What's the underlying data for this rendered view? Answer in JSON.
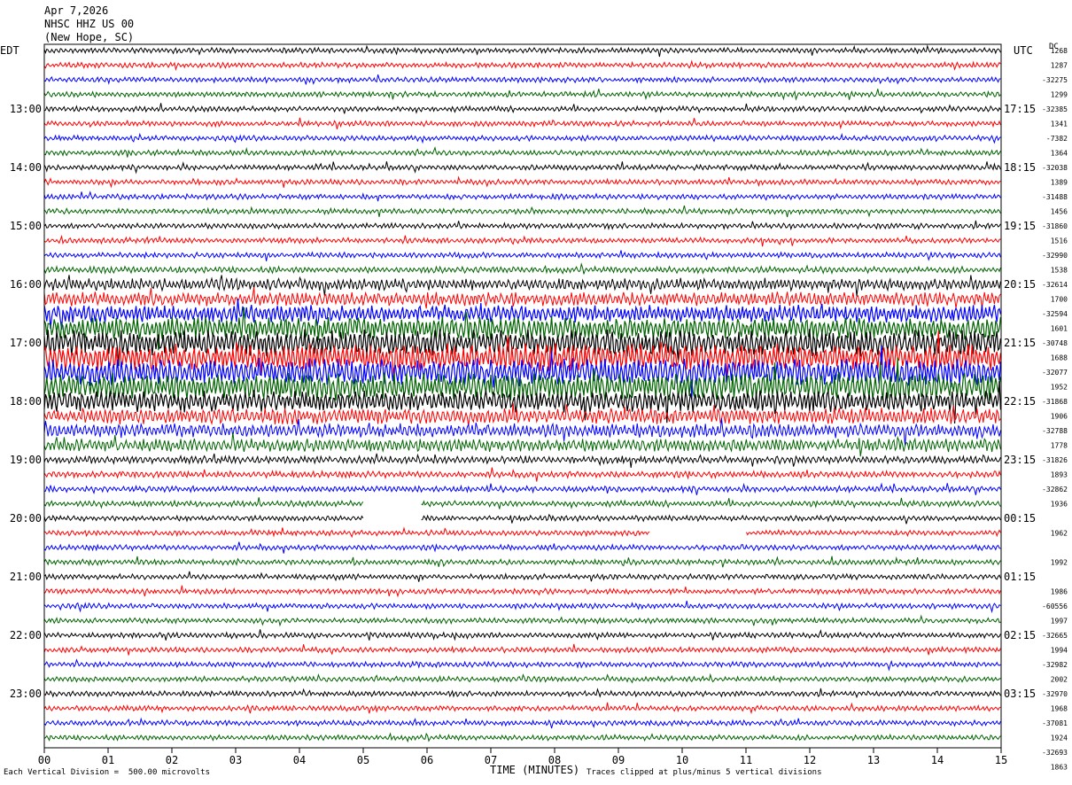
{
  "header": {
    "date": "Apr 7,2026",
    "station": "NHSC HHZ US 00",
    "location": "(New Hope, SC)"
  },
  "left_axis_label": "EDT",
  "right_axis_label": "UTC",
  "dc_label": "DC",
  "footer": {
    "scale_note": "Each Vertical Division =  500.00 microvolts",
    "clip_note": "Traces clipped at plus/minus 5 vertical divisions"
  },
  "colors": {
    "black": "#000000",
    "red": "#ff0000",
    "blue": "#0000ff",
    "green": "#006400",
    "axis": "#000000"
  },
  "chart_data": {
    "type": "line",
    "xlabel": "TIME (MINUTES)",
    "x_ticks": [
      "00",
      "01",
      "02",
      "03",
      "04",
      "05",
      "06",
      "07",
      "08",
      "09",
      "10",
      "11",
      "12",
      "13",
      "14",
      "15"
    ],
    "xlim": [
      0,
      15
    ],
    "left_times": [
      "13:00",
      "14:00",
      "15:00",
      "16:00",
      "17:00",
      "18:00",
      "19:00",
      "20:00",
      "21:00",
      "22:00",
      "23:00"
    ],
    "right_times": [
      "17:15",
      "18:15",
      "19:15",
      "20:15",
      "21:15",
      "22:15",
      "23:15",
      "00:15",
      "01:15",
      "02:15",
      "03:15"
    ],
    "dc_offsets": [
      "1268",
      "1287",
      "-32275",
      "1299",
      "-32385",
      "1341",
      "-7382",
      "1364",
      "-32038",
      "1389",
      "-31488",
      "1456",
      "-31860",
      "1516",
      "-32990",
      "1538",
      "-32614",
      "1700",
      "-32594",
      "1601",
      "-30748",
      "1688",
      "-32077",
      "1952",
      "-31868",
      "1906",
      "-32788",
      "1778",
      "-31826",
      "1893",
      "-32862",
      "1936",
      "",
      "1962",
      "",
      "1992",
      "",
      "1986",
      "-60556",
      "1997",
      "-32665",
      "1994",
      "-32982",
      "2002",
      "-32970",
      "1968",
      "-37081",
      "1924",
      "-32693",
      "1863"
    ],
    "trace_count": 48,
    "trace_colors": [
      "black",
      "red",
      "blue",
      "green"
    ],
    "trace_amplitude_level": [
      1,
      1,
      1,
      1,
      1,
      1,
      1,
      1,
      1,
      1,
      1,
      1,
      1,
      1,
      1,
      1.2,
      2.2,
      2.6,
      3.2,
      4.2,
      5,
      5,
      5,
      5,
      4,
      3,
      2.6,
      2.4,
      1.4,
      1.2,
      1.1,
      1.1,
      1,
      1,
      1,
      1,
      1,
      1,
      1,
      1,
      1,
      1,
      1,
      1,
      1,
      1,
      1,
      1
    ],
    "gaps": [
      {
        "trace": 31,
        "start_min": 5.0,
        "end_min": 5.9
      },
      {
        "trace": 32,
        "start_min": 5.0,
        "end_min": 5.9
      },
      {
        "trace": 33,
        "start_min": 9.5,
        "end_min": 11.0
      }
    ]
  }
}
